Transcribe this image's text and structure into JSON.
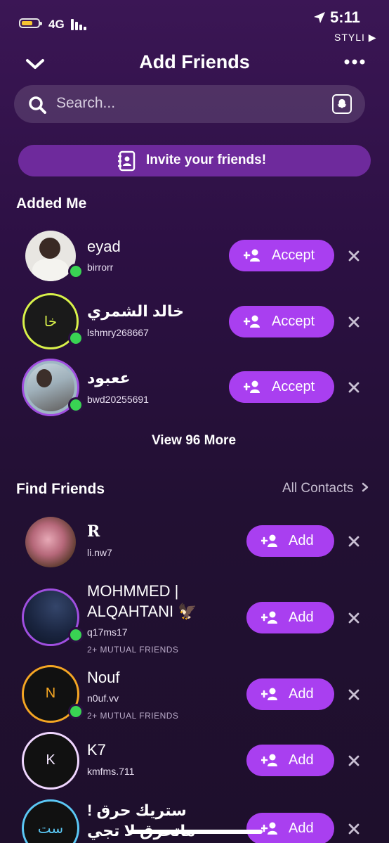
{
  "status": {
    "network": "4G",
    "time": "5:11",
    "carrier": "STYLI ▶"
  },
  "header": {
    "title": "Add Friends"
  },
  "search": {
    "placeholder": "Search..."
  },
  "invite": {
    "label": "Invite your friends!"
  },
  "added_me": {
    "title": "Added Me",
    "items": [
      {
        "name": "eyad",
        "username": "birrorr",
        "action": "Accept"
      },
      {
        "name": "خالد الشمري",
        "username": "lshmry268667",
        "initials": "خا",
        "action": "Accept"
      },
      {
        "name": "ععبود",
        "username": "bwd20255691",
        "action": "Accept"
      }
    ],
    "view_more": "View 96 More"
  },
  "find_friends": {
    "title": "Find Friends",
    "all_contacts": "All Contacts",
    "items": [
      {
        "name": "R",
        "username": "li.nw7",
        "action": "Add"
      },
      {
        "name": "MOHMMED | ALQAHTANI 🦅",
        "username": "q17ms17",
        "mutual": "2+ MUTUAL FRIENDS",
        "action": "Add"
      },
      {
        "name": "Nouf",
        "username": "n0uf.vv",
        "mutual": "2+ MUTUAL FRIENDS",
        "initials": "N",
        "action": "Add"
      },
      {
        "name": "K7",
        "username": "kmfms.711",
        "initials": "K",
        "action": "Add"
      },
      {
        "name": "ستريك حرق !ماتحرق لا تجي",
        "initials": "ست",
        "action": "Add"
      }
    ]
  },
  "colors": {
    "accent": "#a93ff0",
    "online": "#39d353",
    "invite_bg": "#6e2a9c"
  }
}
